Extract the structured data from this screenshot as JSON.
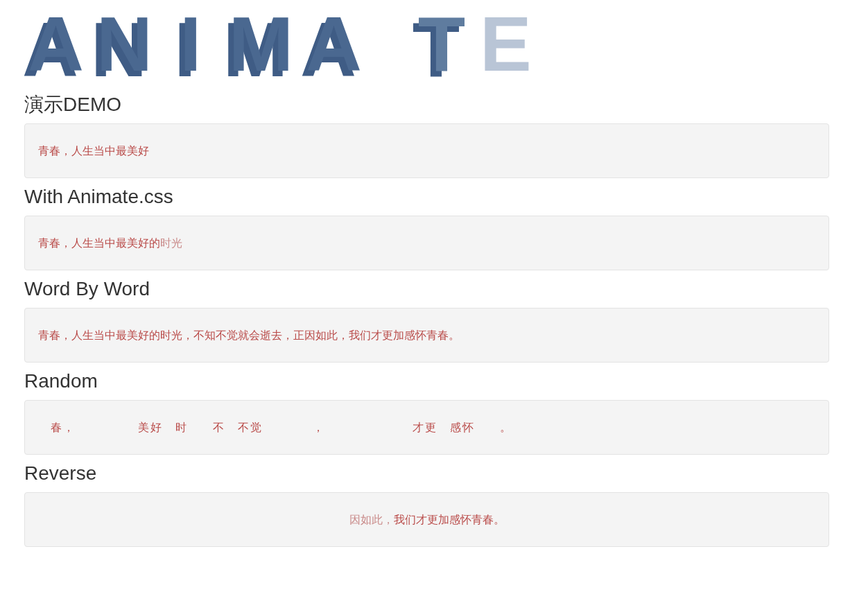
{
  "logo": {
    "letters": [
      {
        "char": "A",
        "kind": "solid"
      },
      {
        "char": "N",
        "kind": "solid"
      },
      {
        "char": "I",
        "kind": "solid"
      },
      {
        "char": "M",
        "kind": "solid"
      },
      {
        "char": "A",
        "kind": "solid"
      },
      {
        "char": "T",
        "kind": "fading"
      },
      {
        "char": "E",
        "kind": "faint"
      }
    ]
  },
  "sections": [
    {
      "title": "演示DEMO",
      "kind": "plain",
      "segments": [
        {
          "text": "青春，人生当中最美好",
          "faded": false
        }
      ]
    },
    {
      "title": "With Animate.css",
      "kind": "plain",
      "segments": [
        {
          "text": "青春，人生当中最美好的",
          "faded": false
        },
        {
          "text": "时光",
          "faded": true
        }
      ]
    },
    {
      "title": "Word By Word",
      "kind": "plain",
      "segments": [
        {
          "text": "青春，人生当中最美好的时光，不知不觉就会逝去，正因如此，我们才更加感怀青春。",
          "faded": false
        }
      ]
    },
    {
      "title": "Random",
      "kind": "slots",
      "slots": [
        {
          "kind": "gap"
        },
        {
          "kind": "char",
          "text": "春"
        },
        {
          "kind": "char",
          "text": "，"
        },
        {
          "kind": "gap"
        },
        {
          "kind": "gap"
        },
        {
          "kind": "gap"
        },
        {
          "kind": "gap"
        },
        {
          "kind": "gap"
        },
        {
          "kind": "char",
          "text": "美"
        },
        {
          "kind": "char",
          "text": "好"
        },
        {
          "kind": "gap"
        },
        {
          "kind": "char",
          "text": "时"
        },
        {
          "kind": "gap"
        },
        {
          "kind": "gap"
        },
        {
          "kind": "char",
          "text": "不"
        },
        {
          "kind": "gap"
        },
        {
          "kind": "char",
          "text": "不"
        },
        {
          "kind": "char",
          "text": "觉"
        },
        {
          "kind": "gap"
        },
        {
          "kind": "gap"
        },
        {
          "kind": "gap"
        },
        {
          "kind": "gap"
        },
        {
          "kind": "char",
          "text": "，"
        },
        {
          "kind": "gap"
        },
        {
          "kind": "gap"
        },
        {
          "kind": "gap"
        },
        {
          "kind": "gap"
        },
        {
          "kind": "gap"
        },
        {
          "kind": "gap"
        },
        {
          "kind": "gap"
        },
        {
          "kind": "char",
          "text": "才"
        },
        {
          "kind": "char",
          "text": "更"
        },
        {
          "kind": "gap"
        },
        {
          "kind": "char",
          "text": "感"
        },
        {
          "kind": "char",
          "text": "怀"
        },
        {
          "kind": "gap"
        },
        {
          "kind": "gap"
        },
        {
          "kind": "char",
          "text": "。"
        }
      ]
    },
    {
      "title": "Reverse",
      "kind": "centered",
      "segments": [
        {
          "text": "因如此，",
          "faded": true
        },
        {
          "text": "我们才更加感怀青春。",
          "faded": false
        }
      ]
    }
  ]
}
